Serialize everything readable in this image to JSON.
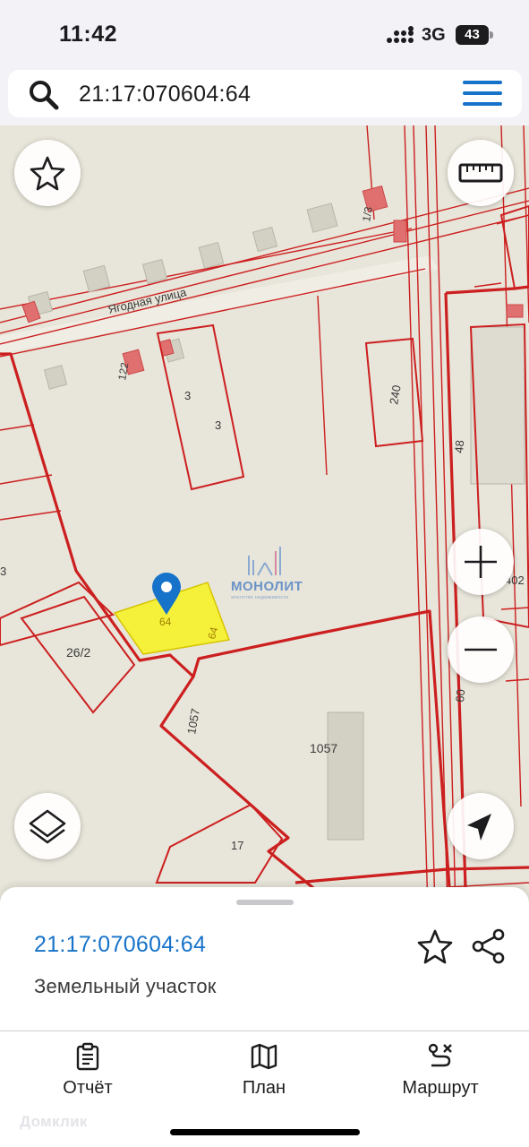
{
  "status_bar": {
    "time": "11:42",
    "network": "3G",
    "battery": "43"
  },
  "search": {
    "query": "21:17:070604:64"
  },
  "map": {
    "street_label": "Ягодная улица",
    "parcel_labels": [
      "122",
      "3",
      "3",
      "240",
      "48",
      "402",
      "3",
      "26/2",
      "64",
      "64",
      "1057",
      "1057",
      "60",
      "17",
      "1/3"
    ],
    "watermark": {
      "title": "МОНОЛИТ",
      "subtitle": "агентство недвижимости"
    },
    "colors": {
      "parcel_border": "#cc1f1f",
      "selected_fill": "#f5f13a",
      "pin": "#1773c9"
    }
  },
  "sheet": {
    "cadastral_number": "21:17:070604:64",
    "object_type": "Земельный участок"
  },
  "tabs": [
    {
      "label": "Отчёт",
      "icon": "report-icon"
    },
    {
      "label": "План",
      "icon": "map-plan-icon"
    },
    {
      "label": "Маршрут",
      "icon": "route-icon"
    }
  ],
  "brand": "Домклик"
}
